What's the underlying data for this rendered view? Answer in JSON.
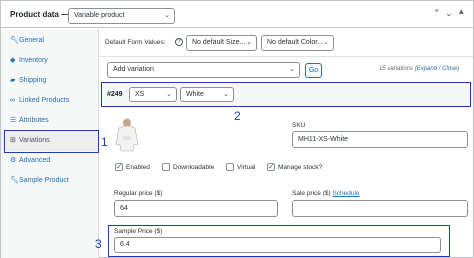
{
  "header": {
    "title": "Product data —",
    "product_type": "Variable product"
  },
  "sidebar": {
    "items": [
      {
        "label": "General",
        "icon": "wrench"
      },
      {
        "label": "Inventory",
        "icon": "diamond"
      },
      {
        "label": "Shipping",
        "icon": "truck"
      },
      {
        "label": "Linked Products",
        "icon": "link"
      },
      {
        "label": "Attributes",
        "icon": "list"
      },
      {
        "label": "Variations",
        "icon": "grid"
      },
      {
        "label": "Advanced",
        "icon": "gear"
      },
      {
        "label": "Sample Product",
        "icon": "wrench"
      }
    ]
  },
  "defaults": {
    "label": "Default Form Values:",
    "size_placeholder": "No default Size...",
    "color_placeholder": "No default Color..."
  },
  "toolbar": {
    "add_variation": "Add variation",
    "go": "Go",
    "count_text": "15 variations (",
    "expand": "Expand",
    "sep": " / ",
    "close": "Close",
    "end": ")"
  },
  "variation": {
    "id": "#249",
    "size": "XS",
    "color": "White",
    "sku_label": "SKU",
    "sku_value": "MH11-XS-White",
    "enabled": "Enabled",
    "downloadable": "Downloadable",
    "virtual": "Virtual",
    "manage_stock": "Manage stock?",
    "regular_label": "Regular price ($)",
    "regular_value": "64",
    "sale_label": "Sale price ($)",
    "schedule": "Schedule",
    "sample_label": "Sample Price ($)",
    "sample_value": "6.4"
  },
  "annotations": {
    "one": "1",
    "two": "2",
    "three": "3"
  }
}
